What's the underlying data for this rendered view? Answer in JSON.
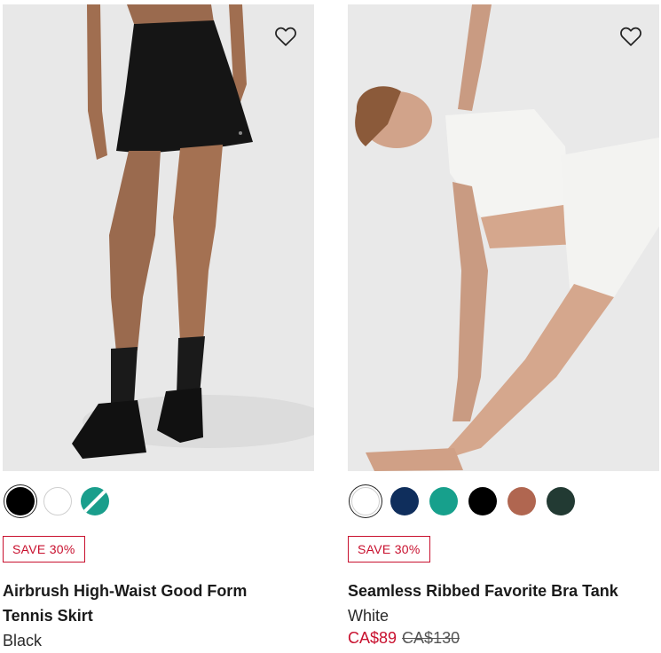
{
  "products": [
    {
      "image_alt": "Model wearing black tennis skirt and black sneakers",
      "wishlist_icon": "heart-icon",
      "swatches": [
        {
          "name": "Black",
          "color": "#000000",
          "selected": true
        },
        {
          "name": "White",
          "color": "#ffffff",
          "selected": false
        },
        {
          "name": "Teal",
          "color": "#1a9e8c",
          "selected": false,
          "pattern": "stripe"
        }
      ],
      "badge": "SAVE 30%",
      "title_line1": "Airbrush High-Waist Good Form",
      "title_line2": "Tennis Skirt",
      "color_name": "Black"
    },
    {
      "image_alt": "Model in white bra tank doing a triangle yoga pose",
      "wishlist_icon": "heart-icon",
      "swatches": [
        {
          "name": "White",
          "color": "#ffffff",
          "selected": true
        },
        {
          "name": "Navy",
          "color": "#0f2e5c",
          "selected": false
        },
        {
          "name": "Teal",
          "color": "#17a08c",
          "selected": false
        },
        {
          "name": "Black",
          "color": "#000000",
          "selected": false
        },
        {
          "name": "Terracotta",
          "color": "#b06650",
          "selected": false
        },
        {
          "name": "Forest",
          "color": "#223a33",
          "selected": false
        }
      ],
      "badge": "SAVE 30%",
      "title": "Seamless Ribbed Favorite Bra Tank",
      "color_name": "White",
      "sale_price": "CA$89",
      "original_price": "CA$130"
    }
  ],
  "colors": {
    "sale_red": "#c8102e",
    "photo_bg": "#e9e9e9"
  }
}
